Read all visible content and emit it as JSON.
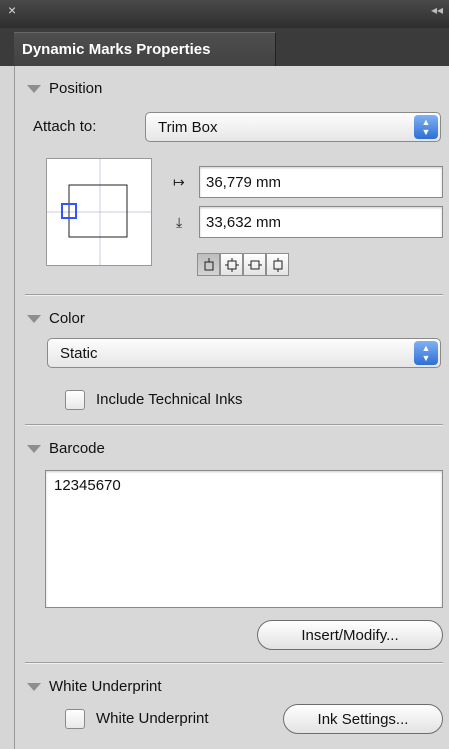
{
  "window": {
    "close_glyph": "×",
    "collapse_glyph": "◂◂",
    "tab_title": "Dynamic Marks Properties"
  },
  "position": {
    "header": "Position",
    "attach_label": "Attach to:",
    "attach_value": "Trim Box",
    "x_value": "36,779 mm",
    "y_value": "33,632 mm",
    "anchor_buttons": [
      "anchor-top-icon",
      "anchor-all-sides-icon",
      "anchor-left-right-icon",
      "anchor-top-bottom-icon"
    ],
    "selected_anchor_index": 0
  },
  "color": {
    "header": "Color",
    "mode_value": "Static",
    "include_technical_inks_label": "Include Technical Inks",
    "include_technical_inks_checked": false
  },
  "barcode": {
    "header": "Barcode",
    "value": "12345670",
    "insert_button": "Insert/Modify..."
  },
  "white_underprint": {
    "header": "White Underprint",
    "checkbox_label": "White Underprint",
    "checkbox_checked": false,
    "ink_settings_button": "Ink Settings..."
  },
  "colors": {
    "accent_blue": "#2f6fd4",
    "preview_marker": "#3355ff"
  }
}
